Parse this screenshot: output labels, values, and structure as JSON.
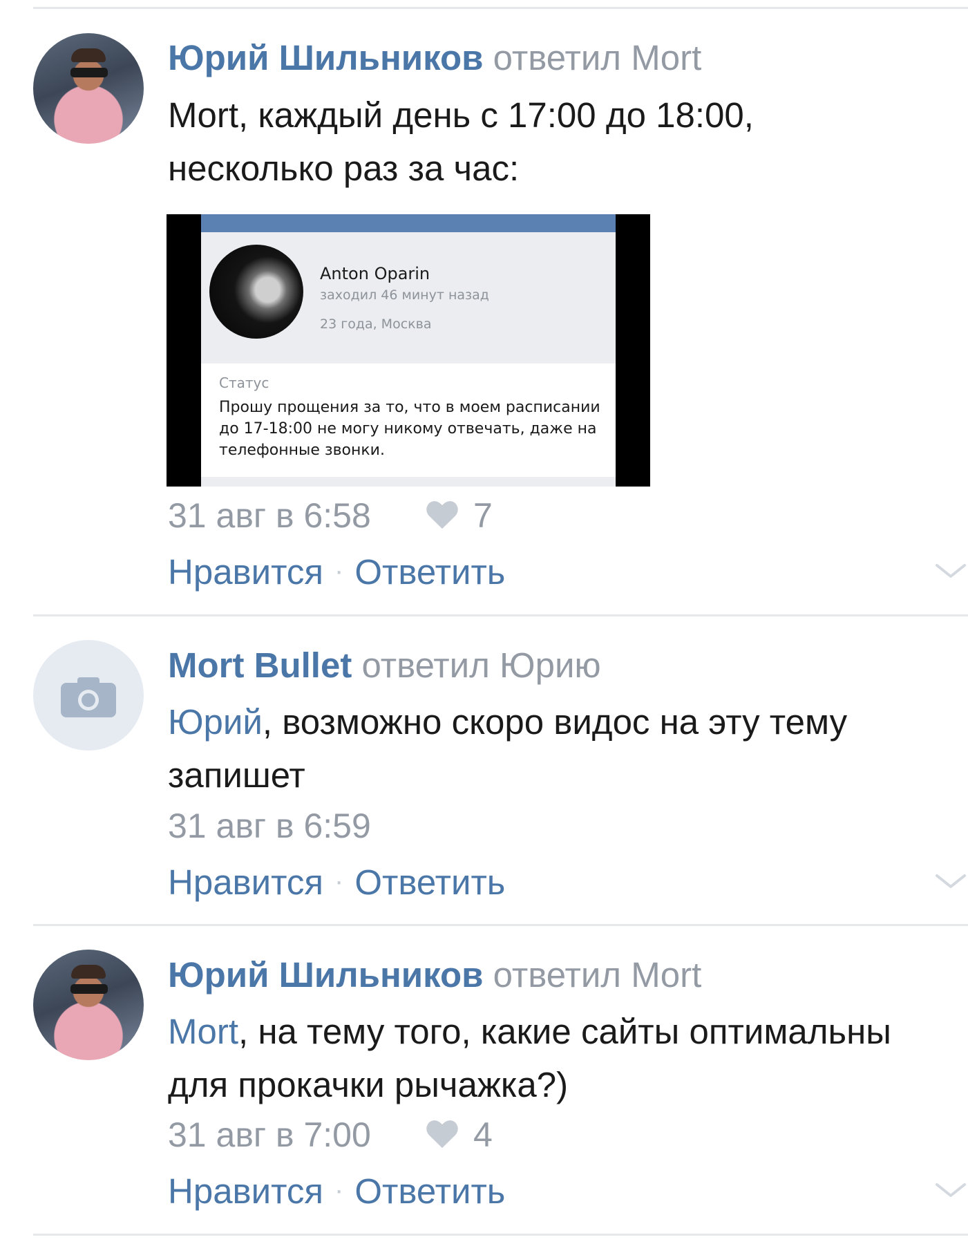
{
  "comments": [
    {
      "author": "Юрий Шильников",
      "reply_phrase": "ответил Mort",
      "mention": "",
      "text_line1": "Mort, каждый день с 17:00 до 18:00,",
      "text_line2": "несколько раз за час:",
      "time": "31 авг в 6:58",
      "likes": "7",
      "like_label": "Нравится",
      "reply_label": "Ответить",
      "attachment": {
        "name": "Anton Oparin",
        "last_seen": "заходил 46 минут назад",
        "info": "23 года, Москва",
        "status_label": "Статус",
        "status_text": "Прошу прощения за то, что в моем расписании до 17-18:00 не могу никому отвечать, даже на телефонные звонки."
      }
    },
    {
      "author": "Mort Bullet",
      "reply_phrase": "ответил Юрию",
      "mention": "Юрий",
      "text_rest": ", возможно скоро видос на эту тему",
      "text_line2": "запишет",
      "time": "31 авг в 6:59",
      "likes": "",
      "like_label": "Нравится",
      "reply_label": "Ответить"
    },
    {
      "author": "Юрий Шильников",
      "reply_phrase": "ответил Mort",
      "mention": "Mort",
      "text_rest": ", на тему того, какие сайты оптимальны",
      "text_line2": "для прокачки рычажка?)",
      "time": "31 авг в 7:00",
      "likes": "4",
      "like_label": "Нравится",
      "reply_label": "Ответить"
    }
  ],
  "separator": "·",
  "colors": {
    "link": "#4a76a8",
    "muted": "#939aa4",
    "text": "#1a1a1a",
    "divider": "#e7e8ec"
  },
  "icons": {
    "like": "heart-icon",
    "expand": "chevron-down-icon",
    "placeholder_avatar": "camera-icon"
  }
}
